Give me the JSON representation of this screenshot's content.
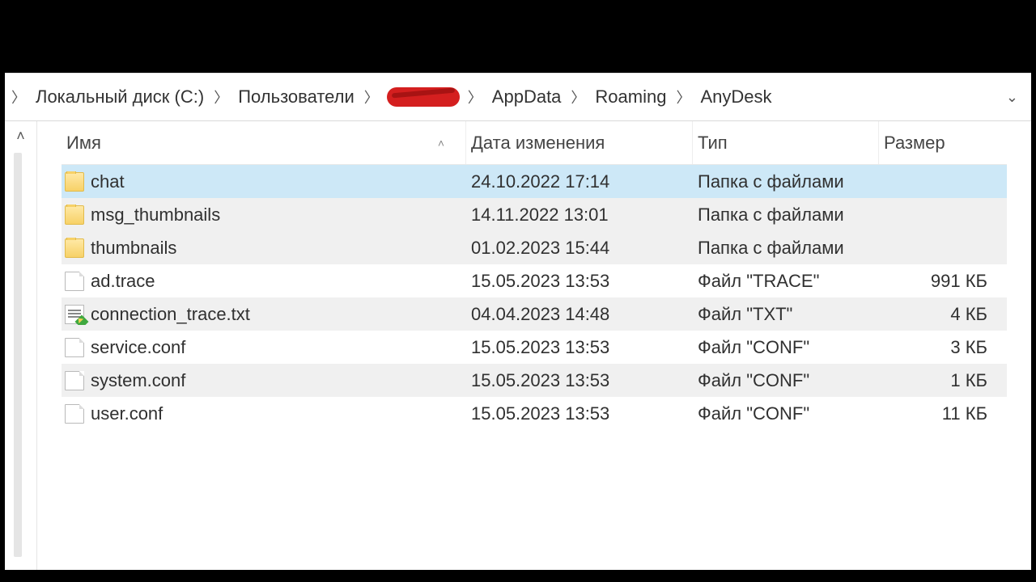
{
  "breadcrumb": {
    "items": [
      "Локальный диск (C:)",
      "Пользователи",
      "",
      "AppData",
      "Roaming",
      "AnyDesk"
    ],
    "redacted_index": 2
  },
  "columns": {
    "name": "Имя",
    "date": "Дата изменения",
    "type": "Тип",
    "size": "Размер"
  },
  "files": [
    {
      "icon": "folder",
      "name": "chat",
      "date": "24.10.2022 17:14",
      "type": "Папка с файлами",
      "size": "",
      "selected": true,
      "alt": false
    },
    {
      "icon": "folder",
      "name": "msg_thumbnails",
      "date": "14.11.2022 13:01",
      "type": "Папка с файлами",
      "size": "",
      "selected": false,
      "alt": true
    },
    {
      "icon": "folder",
      "name": "thumbnails",
      "date": "01.02.2023 15:44",
      "type": "Папка с файлами",
      "size": "",
      "selected": false,
      "alt": true
    },
    {
      "icon": "file",
      "name": "ad.trace",
      "date": "15.05.2023 13:53",
      "type": "Файл \"TRACE\"",
      "size": "991 КБ",
      "selected": false,
      "alt": false
    },
    {
      "icon": "txt",
      "name": "connection_trace.txt",
      "date": "04.04.2023 14:48",
      "type": "Файл \"TXT\"",
      "size": "4 КБ",
      "selected": false,
      "alt": true
    },
    {
      "icon": "file",
      "name": "service.conf",
      "date": "15.05.2023 13:53",
      "type": "Файл \"CONF\"",
      "size": "3 КБ",
      "selected": false,
      "alt": false
    },
    {
      "icon": "file",
      "name": "system.conf",
      "date": "15.05.2023 13:53",
      "type": "Файл \"CONF\"",
      "size": "1 КБ",
      "selected": false,
      "alt": true
    },
    {
      "icon": "file",
      "name": "user.conf",
      "date": "15.05.2023 13:53",
      "type": "Файл \"CONF\"",
      "size": "11 КБ",
      "selected": false,
      "alt": false
    }
  ]
}
